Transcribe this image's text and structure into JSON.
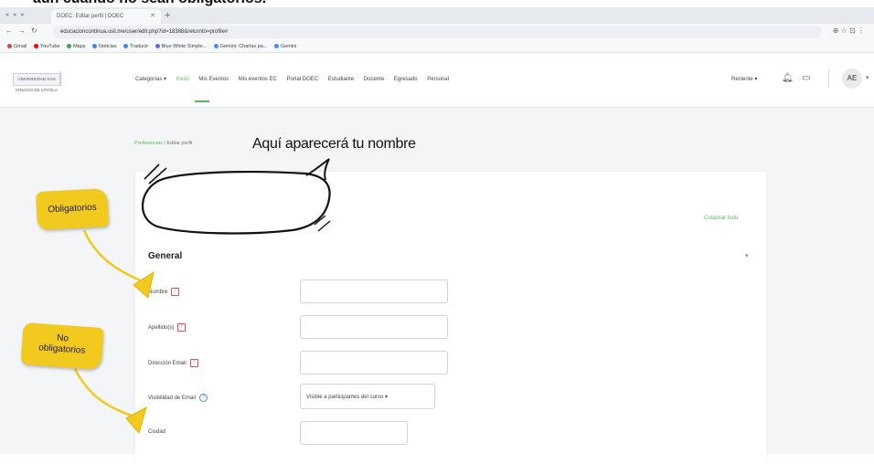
{
  "caption": "aún cuando no sean obligatorios.",
  "browser": {
    "tab_title": "DOEC: Editar perfil | DOEC",
    "new_tab": "+",
    "url": "educacioncontinua.usil.me/user/edit.php?id=18388&returnto=profile#",
    "bookmarks": [
      "Gmail",
      "YouTube",
      "Maps",
      "Noticias",
      "Traducir",
      "Blue White Simple...",
      "Gemini: Charlas pa...",
      "Gemini"
    ],
    "bookmark_colors": [
      "#d44638",
      "#ff0000",
      "#34a853",
      "#4285f4",
      "#4285f4",
      "#5b6cf0",
      "#3f8cff",
      "#3f8cff"
    ]
  },
  "navbar": {
    "logo_text": "UNIVERSIDAD SAN IGNACIO DE LOYOLA",
    "menu": [
      "Categorías",
      "Inicio",
      "Mis Eventos",
      "Mis eventos EC",
      "Portal DOEC",
      "Estudiante",
      "Docente",
      "Egresado",
      "Personal"
    ],
    "active_index": 1,
    "recent": "Reciente",
    "avatar_initials": "AE",
    "accent_color": "#5bb85b"
  },
  "page": {
    "breadcrumb_parent": "Preferencias",
    "breadcrumb_current": "Editar perfil",
    "expand_all": "Colapsar todo",
    "section": "General",
    "fields": [
      {
        "label": "Nombre",
        "required": true
      },
      {
        "label": "Apellido(s)",
        "required": true
      },
      {
        "label": "Dirección Email",
        "required": true
      },
      {
        "label": "Visibilidad de Email",
        "required": false,
        "info": true,
        "value": "Visible a participantes del curso"
      },
      {
        "label": "Ciudad",
        "required": false
      }
    ]
  },
  "annotations": {
    "title": "Aquí aparecerá tu nombre",
    "note_required": "Obligatorios",
    "note_optional_line1": "No",
    "note_optional_line2": "obligatorios",
    "note_color": "#f2c91e"
  }
}
